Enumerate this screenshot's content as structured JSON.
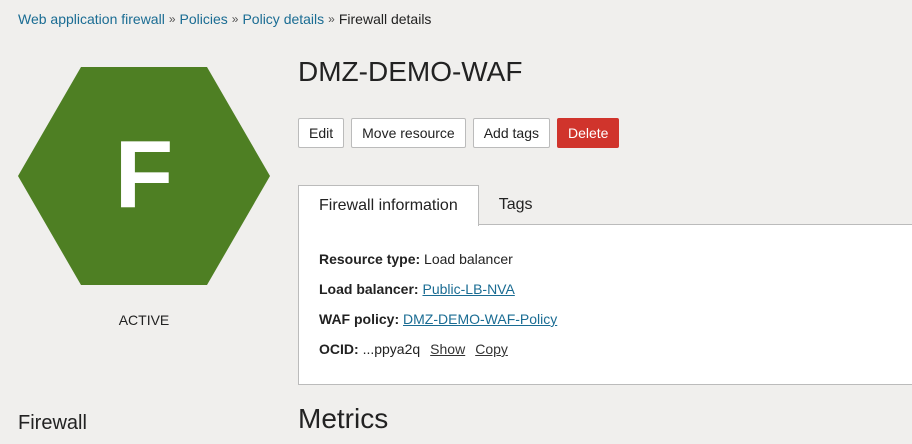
{
  "breadcrumb": {
    "items": [
      "Web application firewall",
      "Policies",
      "Policy details"
    ],
    "current": "Firewall details",
    "separator": "»"
  },
  "resource": {
    "letter": "F",
    "status": "ACTIVE",
    "hex_color": "#4e7f23"
  },
  "title": "DMZ-DEMO-WAF",
  "actions": {
    "edit": "Edit",
    "move": "Move resource",
    "add_tags": "Add tags",
    "delete": "Delete"
  },
  "tabs": [
    "Firewall information",
    "Tags"
  ],
  "info": {
    "resource_type_label": "Resource type:",
    "resource_type": "Load balancer",
    "lb_label": "Load balancer:",
    "lb": "Public-LB-NVA",
    "policy_label": "WAF policy:",
    "policy": "DMZ-DEMO-WAF-Policy",
    "ocid_label": "OCID:",
    "ocid": "...ppya2q",
    "show": "Show",
    "copy": "Copy"
  },
  "sections": {
    "firewall": "Firewall",
    "metrics": "Metrics"
  }
}
